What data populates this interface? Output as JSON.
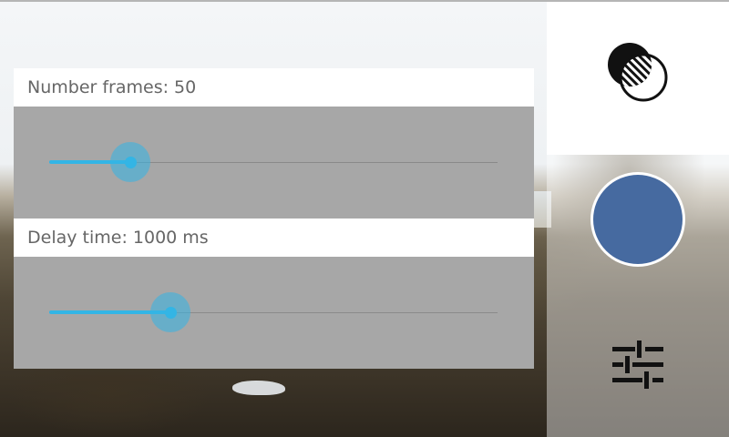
{
  "settings": {
    "frames": {
      "label": "Number frames: 50",
      "value": 50,
      "fraction": 0.18
    },
    "delay": {
      "label": "Delay time: 1000 ms",
      "value": 1000,
      "fraction": 0.27
    }
  },
  "controls": {
    "effect_icon": "overlap-circles-icon",
    "shutter_icon": "shutter-button",
    "settings_icon": "sliders-icon",
    "shutter_color": "#466aa0",
    "accent_color": "#33b5e5"
  }
}
